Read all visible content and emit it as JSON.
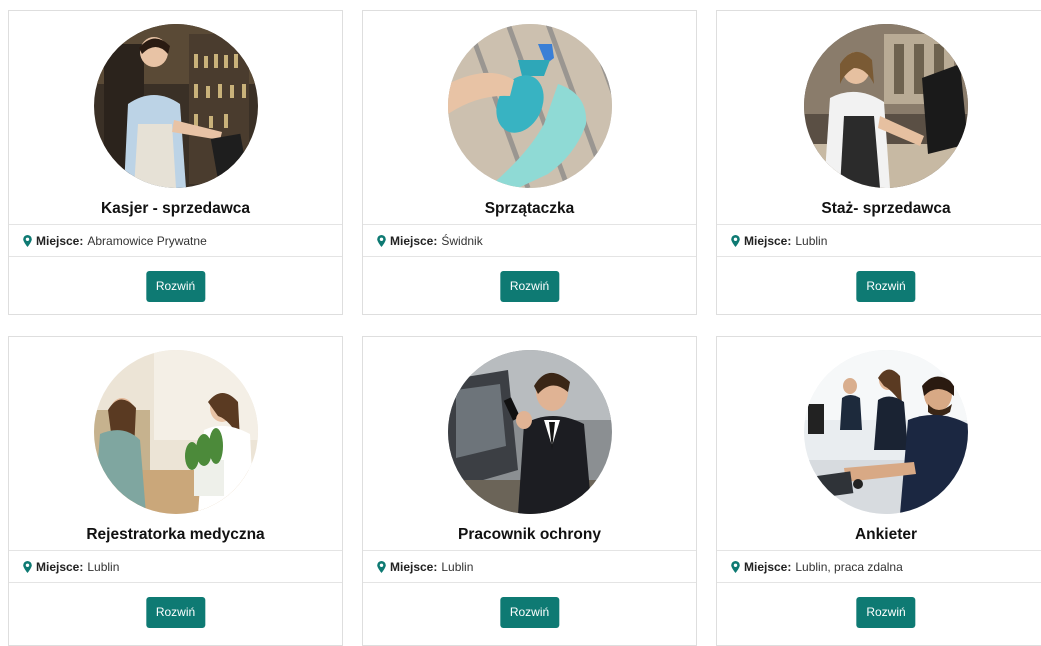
{
  "location_label": "Miejsce:",
  "jobs": [
    {
      "title": "Kasjer - sprzedawca",
      "location": "Abramowice Prywatne",
      "button": "Rozwiń",
      "image": "cashier-photo"
    },
    {
      "title": "Sprzątaczka",
      "location": "Świdnik",
      "button": "Rozwiń",
      "image": "cleaning-photo"
    },
    {
      "title": "Staż- sprzedawca",
      "location": "Lublin",
      "button": "Rozwiń",
      "image": "seller-intern-photo"
    },
    {
      "title": "Rejestratorka medyczna",
      "location": "Lublin",
      "button": "Rozwiń",
      "image": "medical-receptionist-photo"
    },
    {
      "title": "Pracownik ochrony",
      "location": "Lublin",
      "button": "Rozwiń",
      "image": "security-guard-photo"
    },
    {
      "title": "Ankieter",
      "location": "Lublin, praca zdalna",
      "button": "Rozwiń",
      "image": "call-center-photo"
    }
  ],
  "colors": {
    "button": "#0e7a73",
    "pin": "#0e7a73"
  }
}
